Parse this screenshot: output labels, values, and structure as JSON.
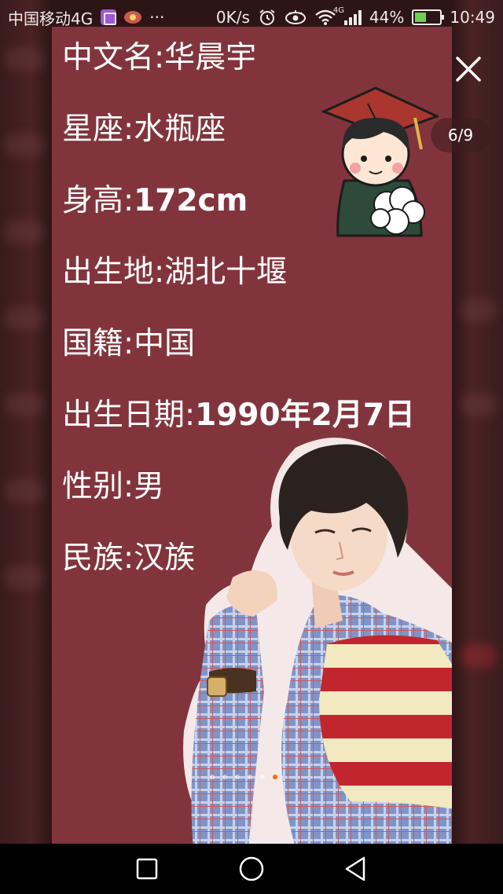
{
  "status_bar": {
    "carrier": "中国移动4G",
    "dots": "···",
    "speed": "0K/s",
    "network": "4G",
    "battery": "44%",
    "time": "10:49"
  },
  "viewer": {
    "counter": "6/9",
    "page_count": 9,
    "active_page": 6
  },
  "profile": {
    "rows": [
      {
        "label": "中文名:",
        "value": "华晨宇"
      },
      {
        "label": "星座:",
        "value": "水瓶座"
      },
      {
        "label": "身高:",
        "value": "172cm"
      },
      {
        "label": "出生地:",
        "value": "湖北十堰"
      },
      {
        "label": "国籍:",
        "value": "中国"
      },
      {
        "label": "出生日期:",
        "value": "1990年2月7日"
      },
      {
        "label": "性别:",
        "value": "男"
      },
      {
        "label": "民族:",
        "value": "汉族"
      }
    ]
  },
  "colors": {
    "card_bg": "#82343c",
    "dot_active": "#ff6a00",
    "battery_fill": "#6cd24f"
  },
  "icons": [
    "alarm-icon",
    "eye-icon",
    "wifi-icon",
    "close-icon",
    "square-nav-icon",
    "circle-nav-icon",
    "triangle-back-icon"
  ]
}
